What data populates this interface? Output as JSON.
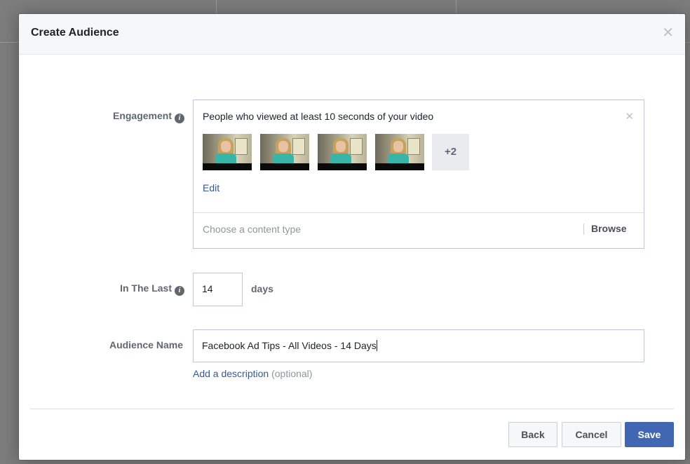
{
  "dialog": {
    "title": "Create Audience",
    "close_icon": "close-icon"
  },
  "engagement": {
    "label": "Engagement",
    "info_icon": "info-icon",
    "selection": "People who viewed at least 10 seconds of your video",
    "more_count": "+2",
    "edit_label": "Edit",
    "content_type_placeholder": "Choose a content type",
    "browse_label": "Browse"
  },
  "in_the_last": {
    "label": "In The Last",
    "value": "14",
    "unit": "days"
  },
  "audience_name": {
    "label": "Audience Name",
    "value": "Facebook Ad Tips - All Videos - 14 Days",
    "description_link": "Add a description",
    "description_optional": "(optional)"
  },
  "footer": {
    "back_label": "Back",
    "cancel_label": "Cancel",
    "save_label": "Save"
  },
  "colors": {
    "primary": "#4267b2",
    "link": "#365899",
    "border": "#bdc7d8"
  }
}
